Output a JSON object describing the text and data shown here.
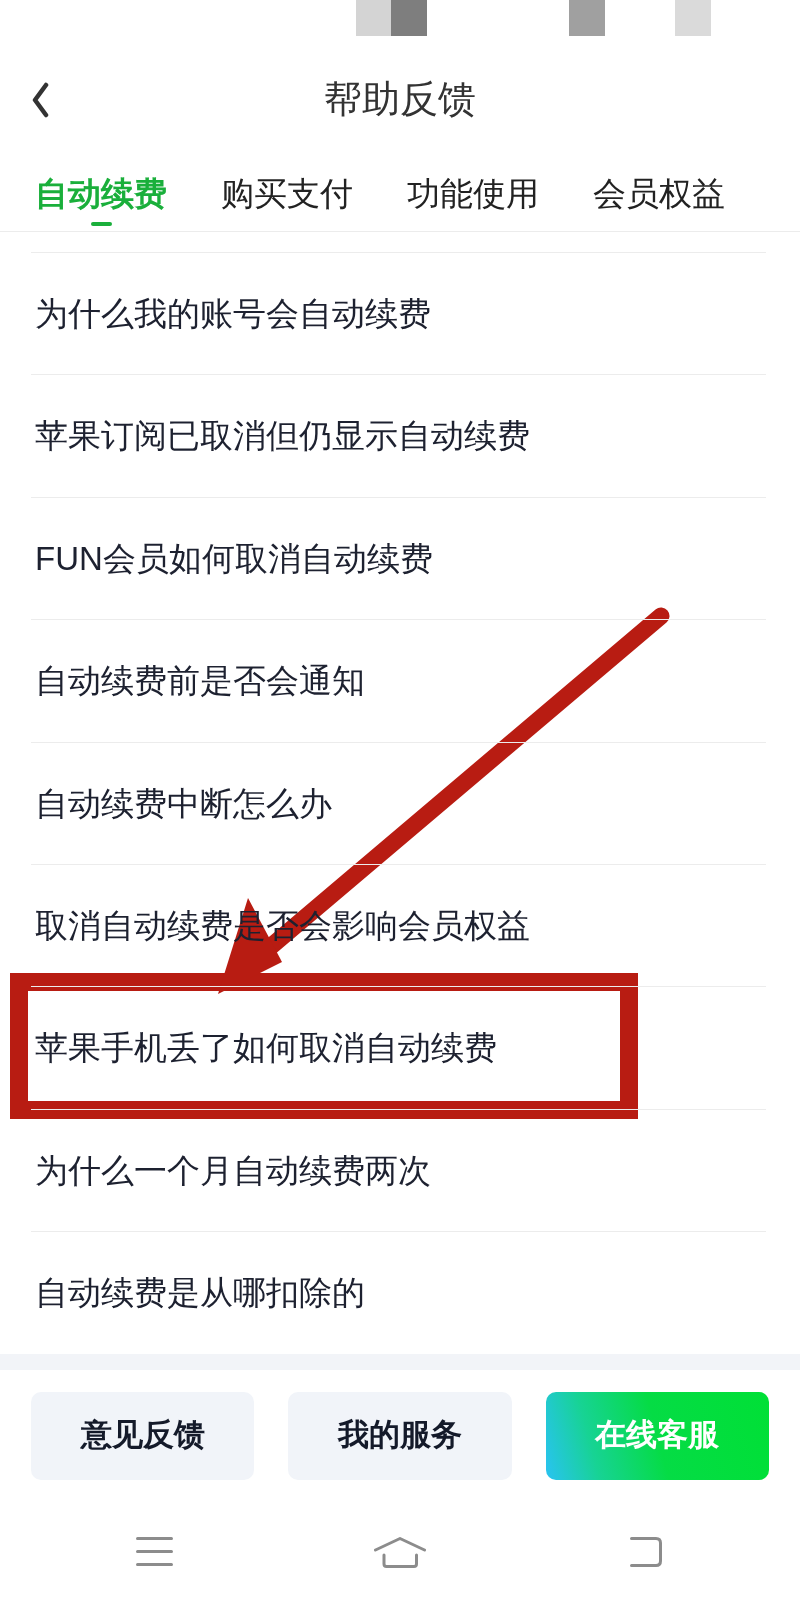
{
  "header": {
    "title": "帮助反馈"
  },
  "tabs": [
    {
      "label": "自动续费",
      "selected": true
    },
    {
      "label": "购买支付",
      "selected": false
    },
    {
      "label": "功能使用",
      "selected": false
    },
    {
      "label": "会员权益",
      "selected": false
    }
  ],
  "items": [
    {
      "text": "为什么我的账号会自动续费",
      "highlighted": false
    },
    {
      "text": "苹果订阅已取消但仍显示自动续费",
      "highlighted": false
    },
    {
      "text": "FUN会员如何取消自动续费",
      "highlighted": false
    },
    {
      "text": "自动续费前是否会通知",
      "highlighted": false
    },
    {
      "text": "自动续费中断怎么办",
      "highlighted": false
    },
    {
      "text": "取消自动续费是否会影响会员权益",
      "highlighted": false
    },
    {
      "text": "苹果手机丢了如何取消自动续费",
      "highlighted": true
    },
    {
      "text": "为什么一个月自动续费两次",
      "highlighted": false
    },
    {
      "text": "自动续费是从哪扣除的",
      "highlighted": false
    }
  ],
  "buttons": [
    {
      "label": "意见反馈",
      "kind": "secondary"
    },
    {
      "label": "我的服务",
      "kind": "secondary"
    },
    {
      "label": "在线客服",
      "kind": "primary"
    }
  ]
}
